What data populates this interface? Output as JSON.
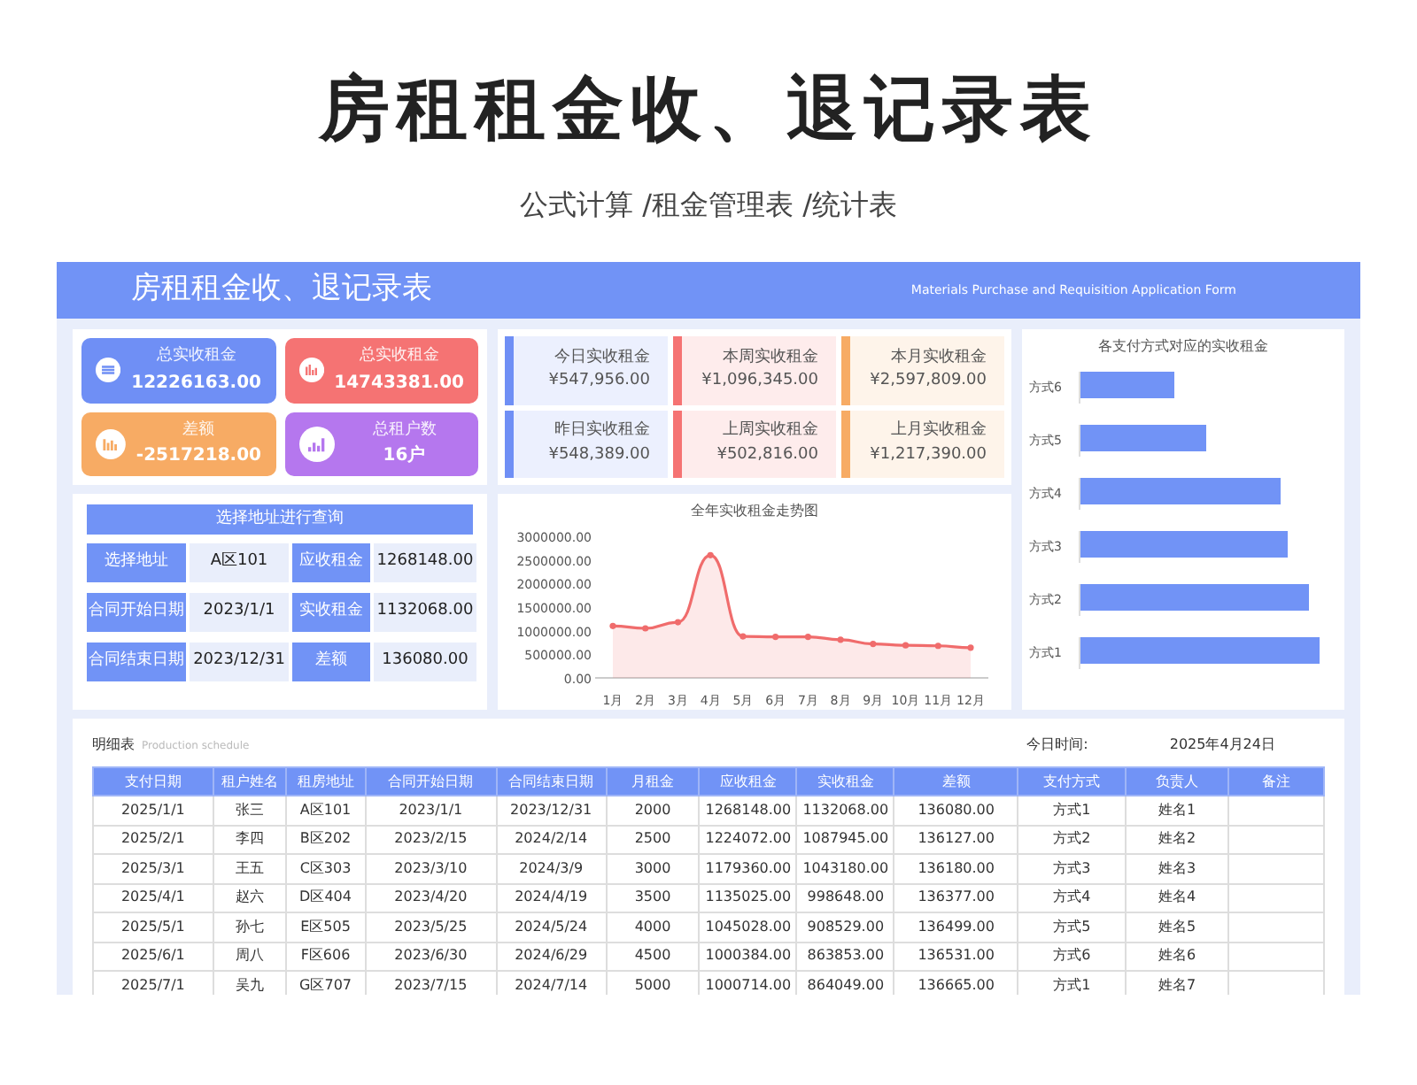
{
  "title": "房租租金收、退记录表",
  "subtitle": "公式计算 /租金管理表 /统计表",
  "header": {
    "title": "房租租金收、退记录表",
    "subtitle": "Materials Purchase and Requisition Application Form"
  },
  "summary_cards": [
    {
      "label": "总实收租金",
      "value": "12226163.00",
      "color": "#6f8ff5"
    },
    {
      "label": "总实收租金",
      "value": "14743381.00",
      "color": "#f57373"
    },
    {
      "label": "差额",
      "value": "-2517218.00",
      "color": "#f7ab64"
    },
    {
      "label": "总租户数",
      "value": "16户",
      "color": "#b577ee"
    }
  ],
  "query": {
    "title": "选择地址进行查询",
    "fields": [
      {
        "label": "选择地址",
        "value": "A区101"
      },
      {
        "label": "应收租金",
        "value": "1268148.00"
      },
      {
        "label": "合同开始日期",
        "value": "2023/1/1"
      },
      {
        "label": "实收租金",
        "value": "1132068.00"
      },
      {
        "label": "合同结束日期",
        "value": "2023/12/31"
      },
      {
        "label": "差额",
        "value": "136080.00"
      }
    ]
  },
  "period_cards": [
    {
      "label": "今日实收租金",
      "value": "¥547,956.00",
      "color": "#6f8ff5"
    },
    {
      "label": "本周实收租金",
      "value": "¥1,096,345.00",
      "color": "#f57373"
    },
    {
      "label": "本月实收租金",
      "value": "¥2,597,809.00",
      "color": "#f7ab64"
    },
    {
      "label": "昨日实收租金",
      "value": "¥548,389.00",
      "color": "#6f8ff5"
    },
    {
      "label": "上周实收租金",
      "value": "¥502,816.00",
      "color": "#f57373"
    },
    {
      "label": "上月实收租金",
      "value": "¥1,217,390.00",
      "color": "#f7ab64"
    }
  ],
  "trend": {
    "chart_data": {
      "type": "area",
      "title": "全年实收租金走势图",
      "categories": [
        "1月",
        "2月",
        "3月",
        "4月",
        "5月",
        "6月",
        "7月",
        "8月",
        "9月",
        "10月",
        "11月",
        "12月"
      ],
      "series": [
        {
          "color": "#f06c6c",
          "values": [
            1100000,
            1050000,
            1180000,
            2600000,
            880000,
            870000,
            870000,
            810000,
            720000,
            690000,
            680000,
            640000
          ]
        }
      ],
      "ylim": [
        0,
        3000000
      ],
      "yticks": [
        {
          "value": 0,
          "label": "0.00"
        },
        {
          "value": 500000,
          "label": "500000.00"
        },
        {
          "value": 1000000,
          "label": "1000000.00"
        },
        {
          "value": 1500000,
          "label": "1500000.00"
        },
        {
          "value": 2000000,
          "label": "2000000.00"
        },
        {
          "value": 2500000,
          "label": "2500000.00"
        },
        {
          "value": 3000000,
          "label": "3000000.00"
        }
      ]
    }
  },
  "payment_chart": {
    "title": "各支付方式对应的实收租金",
    "categories": [
      "方式6",
      "方式5",
      "方式4",
      "方式3",
      "方式2",
      "方式1"
    ]
  },
  "detail": {
    "title": "明细表",
    "subtitle": "Production schedule",
    "date_label": "今日时间:",
    "date": "2025年4月24日",
    "columns": [
      "支付日期",
      "租户姓名",
      "租房地址",
      "合同开始日期",
      "合同结束日期",
      "月租金",
      "应收租金",
      "实收租金",
      "差额",
      "支付方式",
      "负责人",
      "备注"
    ],
    "rows": [
      [
        "2025/1/1",
        "张三",
        "A区101",
        "2023/1/1",
        "2023/12/31",
        "2000",
        "1268148.00",
        "1132068.00",
        "136080.00",
        "方式1",
        "姓名1",
        ""
      ],
      [
        "2025/2/1",
        "李四",
        "B区202",
        "2023/2/15",
        "2024/2/14",
        "2500",
        "1224072.00",
        "1087945.00",
        "136127.00",
        "方式2",
        "姓名2",
        ""
      ],
      [
        "2025/3/1",
        "王五",
        "C区303",
        "2023/3/10",
        "2024/3/9",
        "3000",
        "1179360.00",
        "1043180.00",
        "136180.00",
        "方式3",
        "姓名3",
        ""
      ],
      [
        "2025/4/1",
        "赵六",
        "D区404",
        "2023/4/20",
        "2024/4/19",
        "3500",
        "1135025.00",
        "998648.00",
        "136377.00",
        "方式4",
        "姓名4",
        ""
      ],
      [
        "2025/5/1",
        "孙七",
        "E区505",
        "2023/5/25",
        "2024/5/24",
        "4000",
        "1045028.00",
        "908529.00",
        "136499.00",
        "方式5",
        "姓名5",
        ""
      ],
      [
        "2025/6/1",
        "周八",
        "F区606",
        "2023/6/30",
        "2024/6/29",
        "4500",
        "1000384.00",
        "863853.00",
        "136531.00",
        "方式6",
        "姓名6",
        ""
      ],
      [
        "2025/7/1",
        "吴九",
        "G区707",
        "2023/7/15",
        "2024/7/14",
        "5000",
        "1000714.00",
        "864049.00",
        "136665.00",
        "方式1",
        "姓名7",
        ""
      ]
    ]
  }
}
